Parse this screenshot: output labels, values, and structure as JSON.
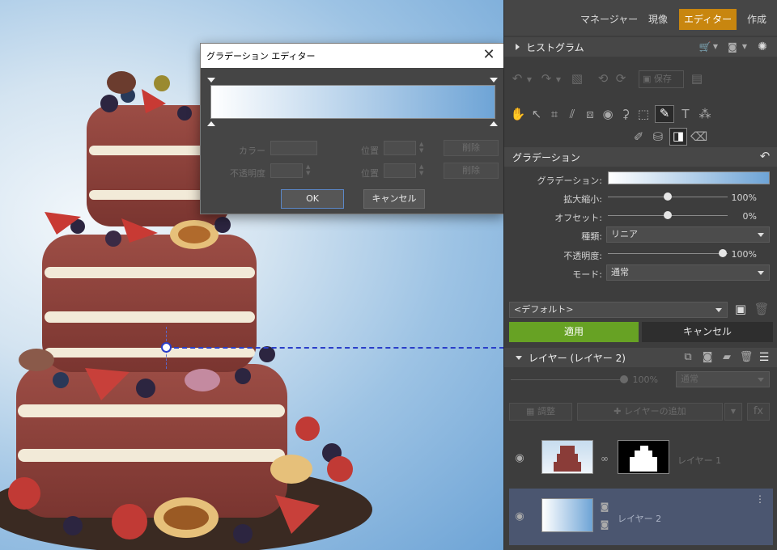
{
  "dialog": {
    "title": "グラデーション エディター",
    "close_glyph": "✕",
    "color_label": "カラー",
    "opacity_label": "不透明度",
    "position_label_1": "位置",
    "position_label_2": "位置",
    "delete_label_1": "削除",
    "delete_label_2": "削除",
    "ok_label": "OK",
    "cancel_label": "キャンセル",
    "gradient_start_color": "#ffffff",
    "gradient_end_color": "#6ea4d6"
  },
  "tabs": [
    {
      "label": "マネージャー"
    },
    {
      "label": "現像"
    },
    {
      "label": "エディター"
    },
    {
      "label": "作成"
    }
  ],
  "histogram": {
    "title": "ヒストグラム"
  },
  "toolbar": {
    "save_label": "保存"
  },
  "gradient_panel": {
    "title": "グラデーション",
    "gradient_label": "グラデーション:",
    "zoom_label": "拡大縮小:",
    "zoom_value": "100%",
    "offset_label": "オフセット:",
    "offset_value": "0%",
    "type_label": "種類:",
    "type_value": "リニア",
    "opacity_label": "不透明度:",
    "opacity_value": "100%",
    "mode_label": "モード:",
    "mode_value": "通常"
  },
  "preset": {
    "value": "<デフォルト>"
  },
  "actions": {
    "apply_label": "適用",
    "cancel_label": "キャンセル"
  },
  "layers": {
    "title": "レイヤー (レイヤー 2)",
    "opacity_value": "100%",
    "blend_value": "通常",
    "adjust_label": "調整",
    "add_layer_label": "レイヤーの追加",
    "fx_label": "fx",
    "items": [
      {
        "name": "レイヤー 1"
      },
      {
        "name": "レイヤー 2"
      }
    ]
  },
  "colors": {
    "accent": "#c8860f",
    "apply": "#67a224",
    "selected_layer": "#4b5670",
    "gradient_guide": "#2a3ec9"
  }
}
